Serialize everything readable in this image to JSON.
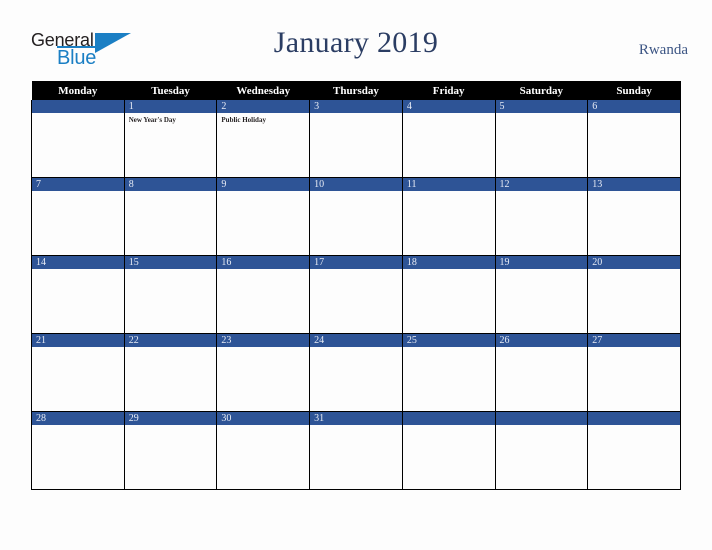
{
  "brand": {
    "name_part1": "General",
    "name_part2": "Blue",
    "logo_icon": "triangle-icon"
  },
  "header": {
    "title": "January 2019",
    "country": "Rwanda"
  },
  "colors": {
    "date_bar": "#2e5496",
    "header_row": "#000000",
    "title_text": "#2b3d63",
    "brand_blue": "#1b7fc4",
    "page_background": "#fdfdfd"
  },
  "calendar": {
    "weekday_headers": [
      "Monday",
      "Tuesday",
      "Wednesday",
      "Thursday",
      "Friday",
      "Saturday",
      "Sunday"
    ],
    "weeks": [
      [
        {
          "date": "",
          "events": []
        },
        {
          "date": "1",
          "events": [
            "New Year's Day"
          ]
        },
        {
          "date": "2",
          "events": [
            "Public Holiday"
          ]
        },
        {
          "date": "3",
          "events": []
        },
        {
          "date": "4",
          "events": []
        },
        {
          "date": "5",
          "events": []
        },
        {
          "date": "6",
          "events": []
        }
      ],
      [
        {
          "date": "7",
          "events": []
        },
        {
          "date": "8",
          "events": []
        },
        {
          "date": "9",
          "events": []
        },
        {
          "date": "10",
          "events": []
        },
        {
          "date": "11",
          "events": []
        },
        {
          "date": "12",
          "events": []
        },
        {
          "date": "13",
          "events": []
        }
      ],
      [
        {
          "date": "14",
          "events": []
        },
        {
          "date": "15",
          "events": []
        },
        {
          "date": "16",
          "events": []
        },
        {
          "date": "17",
          "events": []
        },
        {
          "date": "18",
          "events": []
        },
        {
          "date": "19",
          "events": []
        },
        {
          "date": "20",
          "events": []
        }
      ],
      [
        {
          "date": "21",
          "events": []
        },
        {
          "date": "22",
          "events": []
        },
        {
          "date": "23",
          "events": []
        },
        {
          "date": "24",
          "events": []
        },
        {
          "date": "25",
          "events": []
        },
        {
          "date": "26",
          "events": []
        },
        {
          "date": "27",
          "events": []
        }
      ],
      [
        {
          "date": "28",
          "events": []
        },
        {
          "date": "29",
          "events": []
        },
        {
          "date": "30",
          "events": []
        },
        {
          "date": "31",
          "events": []
        },
        {
          "date": "",
          "events": []
        },
        {
          "date": "",
          "events": []
        },
        {
          "date": "",
          "events": []
        }
      ]
    ]
  }
}
